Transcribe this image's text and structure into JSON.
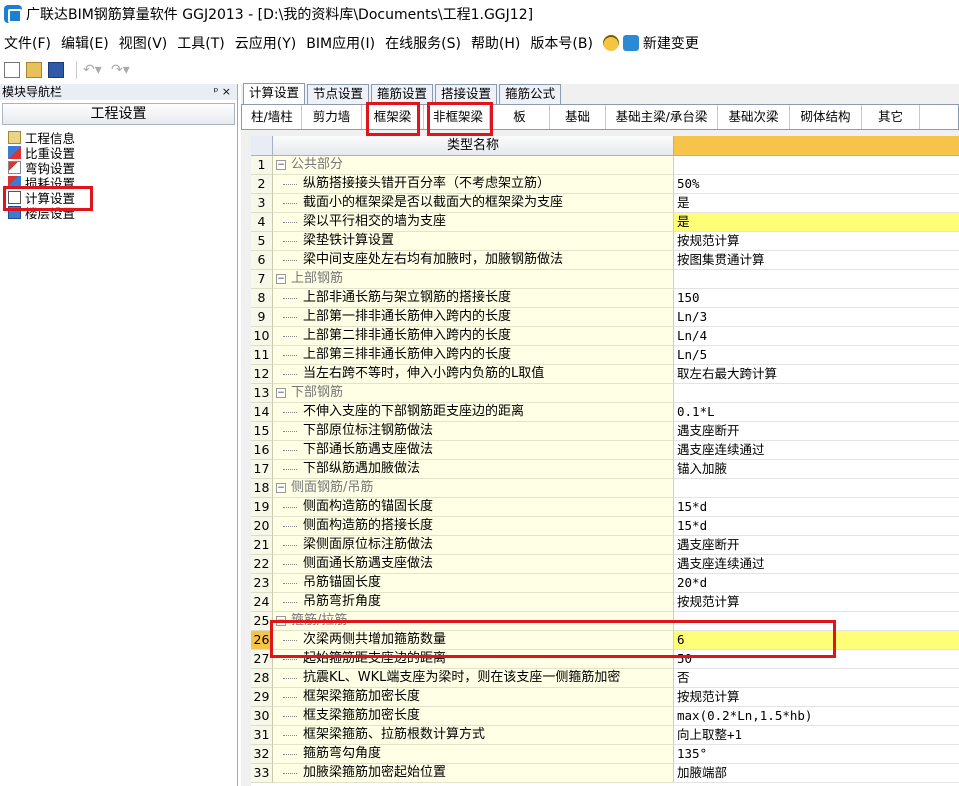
{
  "window": {
    "title": "广联达BIM钢筋算量软件 GGJ2013 - [D:\\我的资料库\\Documents\\工程1.GGJ12]"
  },
  "menu": {
    "items": [
      "文件(F)",
      "编辑(E)",
      "视图(V)",
      "工具(T)",
      "云应用(Y)",
      "BIM应用(I)",
      "在线服务(S)",
      "帮助(H)",
      "版本号(B)"
    ],
    "extra_label": "新建变更"
  },
  "left": {
    "panel_title": "模块导航栏",
    "pin": "ᵖ ×",
    "header": "工程设置",
    "nav": [
      "工程信息",
      "比重设置",
      "弯钩设置",
      "损耗设置",
      "计算设置",
      "楼层设置"
    ]
  },
  "right": {
    "tabs": [
      "计算设置",
      "节点设置",
      "箍筋设置",
      "搭接设置",
      "箍筋公式"
    ],
    "subtabs": [
      "柱/墙柱",
      "剪力墙",
      "框架梁",
      "非框架梁",
      "板",
      "基础",
      "基础主梁/承台梁",
      "基础次梁",
      "砌体结构",
      "其它"
    ],
    "grid_header": "类型名称"
  },
  "rows": [
    {
      "n": "1",
      "name": "公共部分",
      "val": "",
      "section": true
    },
    {
      "n": "2",
      "name": "纵筋搭接接头错开百分率（不考虑架立筋）",
      "val": "50%"
    },
    {
      "n": "3",
      "name": "截面小的框架梁是否以截面大的框架梁为支座",
      "val": "是"
    },
    {
      "n": "4",
      "name": "梁以平行相交的墙为支座",
      "val": "是",
      "hl": true
    },
    {
      "n": "5",
      "name": "梁垫铁计算设置",
      "val": "按规范计算"
    },
    {
      "n": "6",
      "name": "梁中间支座处左右均有加腋时，加腋钢筋做法",
      "val": "按图集贯通计算"
    },
    {
      "n": "7",
      "name": "上部钢筋",
      "val": "",
      "section": true
    },
    {
      "n": "8",
      "name": "上部非通长筋与架立钢筋的搭接长度",
      "val": "150"
    },
    {
      "n": "9",
      "name": "上部第一排非通长筋伸入跨内的长度",
      "val": "Ln/3"
    },
    {
      "n": "10",
      "name": "上部第二排非通长筋伸入跨内的长度",
      "val": "Ln/4"
    },
    {
      "n": "11",
      "name": "上部第三排非通长筋伸入跨内的长度",
      "val": "Ln/5"
    },
    {
      "n": "12",
      "name": "当左右跨不等时，伸入小跨内负筋的L取值",
      "val": "取左右最大跨计算"
    },
    {
      "n": "13",
      "name": "下部钢筋",
      "val": "",
      "section": true
    },
    {
      "n": "14",
      "name": "不伸入支座的下部钢筋距支座边的距离",
      "val": "0.1*L"
    },
    {
      "n": "15",
      "name": "下部原位标注钢筋做法",
      "val": "遇支座断开"
    },
    {
      "n": "16",
      "name": "下部通长筋遇支座做法",
      "val": "遇支座连续通过"
    },
    {
      "n": "17",
      "name": "下部纵筋遇加腋做法",
      "val": "锚入加腋"
    },
    {
      "n": "18",
      "name": "侧面钢筋/吊筋",
      "val": "",
      "section": true
    },
    {
      "n": "19",
      "name": "侧面构造筋的锚固长度",
      "val": "15*d"
    },
    {
      "n": "20",
      "name": "侧面构造筋的搭接长度",
      "val": "15*d"
    },
    {
      "n": "21",
      "name": "梁侧面原位标注筋做法",
      "val": "遇支座断开"
    },
    {
      "n": "22",
      "name": "侧面通长筋遇支座做法",
      "val": "遇支座连续通过"
    },
    {
      "n": "23",
      "name": "吊筋锚固长度",
      "val": "20*d"
    },
    {
      "n": "24",
      "name": "吊筋弯折角度",
      "val": "按规范计算"
    },
    {
      "n": "25",
      "name": "箍筋/拉筋",
      "val": "",
      "section": true
    },
    {
      "n": "26",
      "name": "次梁两侧共增加箍筋数量",
      "val": "6",
      "hl": true,
      "selected": true
    },
    {
      "n": "27",
      "name": "起始箍筋距支座边的距离",
      "val": "50"
    },
    {
      "n": "28",
      "name": "抗震KL、WKL端支座为梁时，则在该支座一侧箍筋加密",
      "val": "否"
    },
    {
      "n": "29",
      "name": "框架梁箍筋加密长度",
      "val": "按规范计算"
    },
    {
      "n": "30",
      "name": "框支梁箍筋加密长度",
      "val": "max(0.2*Ln,1.5*hb)"
    },
    {
      "n": "31",
      "name": "框架梁箍筋、拉筋根数计算方式",
      "val": "向上取整+1"
    },
    {
      "n": "32",
      "name": "箍筋弯勾角度",
      "val": "135°"
    },
    {
      "n": "33",
      "name": "加腋梁箍筋加密起始位置",
      "val": "加腋端部"
    }
  ]
}
